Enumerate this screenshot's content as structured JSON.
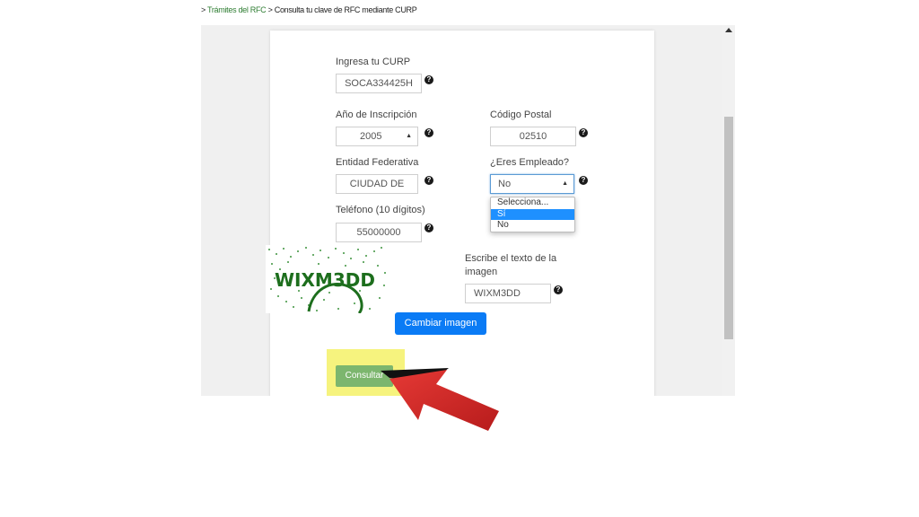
{
  "breadcrumb": {
    "sep1": "> ",
    "link": "Trámites del RFC",
    "sep2": " > ",
    "current": "Consulta tu clave de RFC mediante CURP"
  },
  "form": {
    "curp": {
      "label": "Ingresa tu CURP",
      "value": "SOCA334425H"
    },
    "anio": {
      "label": "Año de Inscripción",
      "value": "2005"
    },
    "cp": {
      "label": "Código Postal",
      "value": "02510"
    },
    "entidad": {
      "label": "Entidad Federativa",
      "value": "CIUDAD DE"
    },
    "empleado": {
      "label": "¿Eres Empleado?",
      "value": "No",
      "options": [
        "Selecciona...",
        "Sí",
        "No"
      ]
    },
    "telefono": {
      "label": "Teléfono (10 dígitos)",
      "value": "55000000"
    },
    "captcha": {
      "label": "Escribe el texto de la imagen",
      "image_text": "WIXM3DD",
      "value": "WIXM3DD",
      "change_button": "Cambiar imagen"
    },
    "submit": "Consultar",
    "help_glyph": "?"
  },
  "colors": {
    "primary_button": "#0a7bf5",
    "submit_button": "#7cb66e",
    "highlight": "#f6f37e",
    "pointer_arrow": "#c62828",
    "breadcrumb_link": "#2e7d32"
  },
  "icons": [
    "help-icon",
    "chevron-updown-icon",
    "scroll-up-icon",
    "pointer-arrow"
  ]
}
